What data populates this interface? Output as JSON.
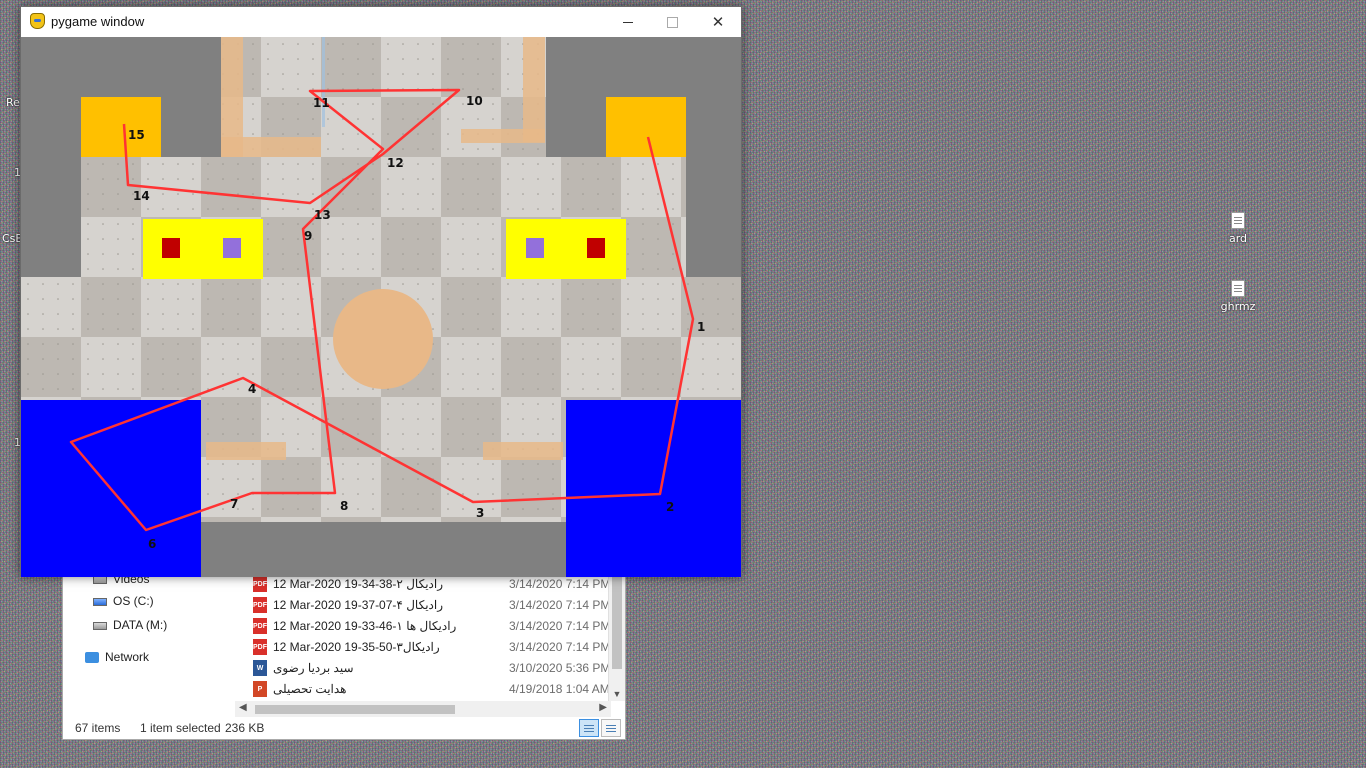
{
  "desktop": {
    "left_fragments": [
      "Re",
      "1",
      "CsB",
      "1"
    ],
    "icons": [
      {
        "label": "ard",
        "icon": "document-icon"
      },
      {
        "label": "ghrmz",
        "icon": "document-icon"
      }
    ]
  },
  "explorer": {
    "nav_items": [
      {
        "label": "Videos",
        "icon": "videos-folder-icon"
      },
      {
        "label": "OS (C:)",
        "icon": "drive-c-icon"
      },
      {
        "label": "DATA (M:)",
        "icon": "drive-m-icon"
      },
      {
        "label": "Network",
        "icon": "network-icon"
      }
    ],
    "files": [
      {
        "name": "12 Mar-2020 19-34-38-رادیکال ۲",
        "date": "3/14/2020 7:14 PM",
        "type": "PDF"
      },
      {
        "name": "12 Mar-2020 19-37-07-رادیکال ۴",
        "date": "3/14/2020 7:14 PM",
        "type": "PDF"
      },
      {
        "name": "12 Mar-2020 19-33-46-رادیکال ها ۱",
        "date": "3/14/2020 7:14 PM",
        "type": "PDF"
      },
      {
        "name": "12 Mar-2020 19-35-50-رادیکال۳",
        "date": "3/14/2020 7:14 PM",
        "type": "PDF"
      },
      {
        "name": "سید بردیا رضوی",
        "date": "3/10/2020 5:36 PM",
        "type": "W"
      },
      {
        "name": "هدایت تحصیلی",
        "date": "4/19/2018 1:04 AM",
        "type": "P"
      }
    ],
    "status": {
      "items_count": "67 items",
      "selection": "1 item selected",
      "size": "236 KB"
    }
  },
  "pygame_window": {
    "title": "pygame window",
    "controls": {
      "minimize": "minimize",
      "maximize": "maximize",
      "close": "✕"
    },
    "colors": {
      "floor_light": "#d6d3cf",
      "floor_dark": "#bdb8b2",
      "wall": "#808080",
      "orange_block": "#ffc000",
      "yellow_block": "#ffff00",
      "red_square": "#c00000",
      "purple_square": "#9370db",
      "blue_zone": "#0000ff",
      "path": "#ff3333",
      "peach": "#e8b888"
    },
    "path_points": [
      {
        "id": "1",
        "label": "1"
      },
      {
        "id": "2",
        "label": "2"
      },
      {
        "id": "3",
        "label": "3"
      },
      {
        "id": "4",
        "label": "4"
      },
      {
        "id": "5",
        "label": "5"
      },
      {
        "id": "6",
        "label": "6"
      },
      {
        "id": "7",
        "label": "7"
      },
      {
        "id": "8",
        "label": "8"
      },
      {
        "id": "9",
        "label": "9"
      },
      {
        "id": "10",
        "label": "10"
      },
      {
        "id": "11",
        "label": "11"
      },
      {
        "id": "12",
        "label": "12"
      },
      {
        "id": "13",
        "label": "13"
      },
      {
        "id": "14",
        "label": "14"
      },
      {
        "id": "15",
        "label": "15"
      }
    ]
  }
}
